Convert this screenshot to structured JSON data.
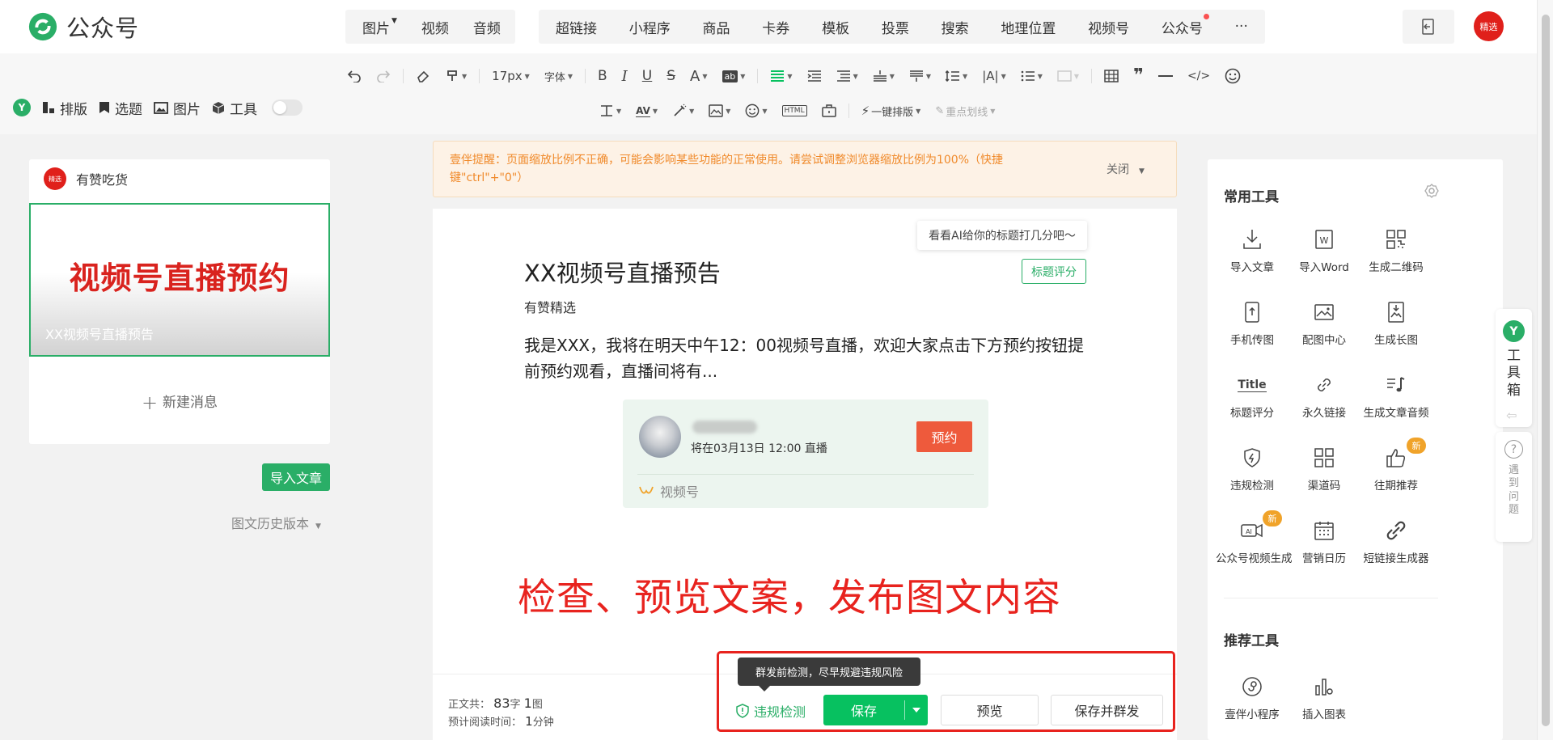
{
  "app": {
    "title": "公众号"
  },
  "nav": {
    "group1": [
      {
        "label": "图片",
        "dropdown": true
      },
      {
        "label": "视频",
        "dropdown": false
      },
      {
        "label": "音频",
        "dropdown": false
      }
    ],
    "group2": [
      {
        "label": "超链接"
      },
      {
        "label": "小程序"
      },
      {
        "label": "商品"
      },
      {
        "label": "卡券"
      },
      {
        "label": "模板"
      },
      {
        "label": "投票"
      },
      {
        "label": "搜索"
      },
      {
        "label": "地理位置"
      },
      {
        "label": "视频号"
      },
      {
        "label": "公众号",
        "dot": true
      },
      {
        "label": "···"
      }
    ]
  },
  "user": {
    "avatar_text": "精选"
  },
  "toolbar": {
    "font_size": "17px",
    "font_family": "字体",
    "one_click_layout": "一键排版",
    "highlight": "重点划线"
  },
  "left_tools": [
    {
      "label": "排版",
      "icon": "layout-icon"
    },
    {
      "label": "选题",
      "icon": "bookmark-icon"
    },
    {
      "label": "图片",
      "icon": "image-icon"
    },
    {
      "label": "工具",
      "icon": "cube-icon"
    }
  ],
  "account": {
    "name": "有赞吃货",
    "avatar_text": "精选"
  },
  "cover": {
    "headline": "视频号直播预约",
    "caption": "XX视频号直播预告"
  },
  "new_message": "新建消息",
  "import_button": "导入文章",
  "history_label": "图文历史版本",
  "warning": {
    "text": "壹伴提醒：页面缩放比例不正确，可能会影响某些功能的正常使用。请尝试调整浏览器缩放比例为100%（快捷键\"ctrl\"+\"0\"）",
    "close": "关闭"
  },
  "article": {
    "ai_tip": "看看AI给你的标题打几分吧～",
    "title_score_btn": "标题评分",
    "title": "XX视频号直播预告",
    "author": "有赞精选",
    "body": "我是XXX，我将在明天中午12：00视频号直播，欢迎大家点击下方预约按钮提前预约观看，直播间将有..."
  },
  "live_card": {
    "time": "将在03月13日 12:00 直播",
    "reserve_btn": "预约",
    "footer": "视频号"
  },
  "annotation": "检查、预览文案，发布图文内容",
  "stats": {
    "body_label": "正文共：",
    "chars": "83",
    "chars_unit": "字",
    "images": "1",
    "images_unit": "图",
    "read_label": "预计阅读时间：",
    "read_value": "1",
    "read_unit": "分钟"
  },
  "actions": {
    "tooltip": "群发前检测，尽早规避违规风险",
    "check": "违规检测",
    "save": "保存",
    "preview": "预览",
    "save_send": "保存并群发"
  },
  "right_panel": {
    "common_title": "常用工具",
    "tools": [
      {
        "label": "导入文章",
        "icon": "import-icon"
      },
      {
        "label": "导入Word",
        "icon": "word-icon"
      },
      {
        "label": "生成二维码",
        "icon": "qrcode-icon"
      },
      {
        "label": "手机传图",
        "icon": "phone-upload-icon"
      },
      {
        "label": "配图中心",
        "icon": "image-center-icon"
      },
      {
        "label": "生成长图",
        "icon": "long-image-icon"
      },
      {
        "label": "标题评分",
        "icon": "title-score-icon",
        "icon_text": "Title"
      },
      {
        "label": "永久链接",
        "icon": "link-icon"
      },
      {
        "label": "生成文章音频",
        "icon": "audio-icon"
      },
      {
        "label": "违规检测",
        "icon": "shield-icon"
      },
      {
        "label": "渠道码",
        "icon": "channel-code-icon"
      },
      {
        "label": "往期推荐",
        "icon": "thumb-up-icon",
        "badge": "新"
      },
      {
        "label": "公众号视频生成",
        "icon": "ai-video-icon",
        "badge": "新"
      },
      {
        "label": "营销日历",
        "icon": "calendar-icon"
      },
      {
        "label": "短链接生成器",
        "icon": "short-link-icon"
      }
    ],
    "recommend_title": "推荐工具",
    "recommend_tools": [
      {
        "label": "壹伴小程序",
        "icon": "miniprogram-icon"
      },
      {
        "label": "插入图表",
        "icon": "chart-icon"
      }
    ]
  },
  "side_float": {
    "toolbox": "工具箱",
    "help": "遇到问题"
  }
}
